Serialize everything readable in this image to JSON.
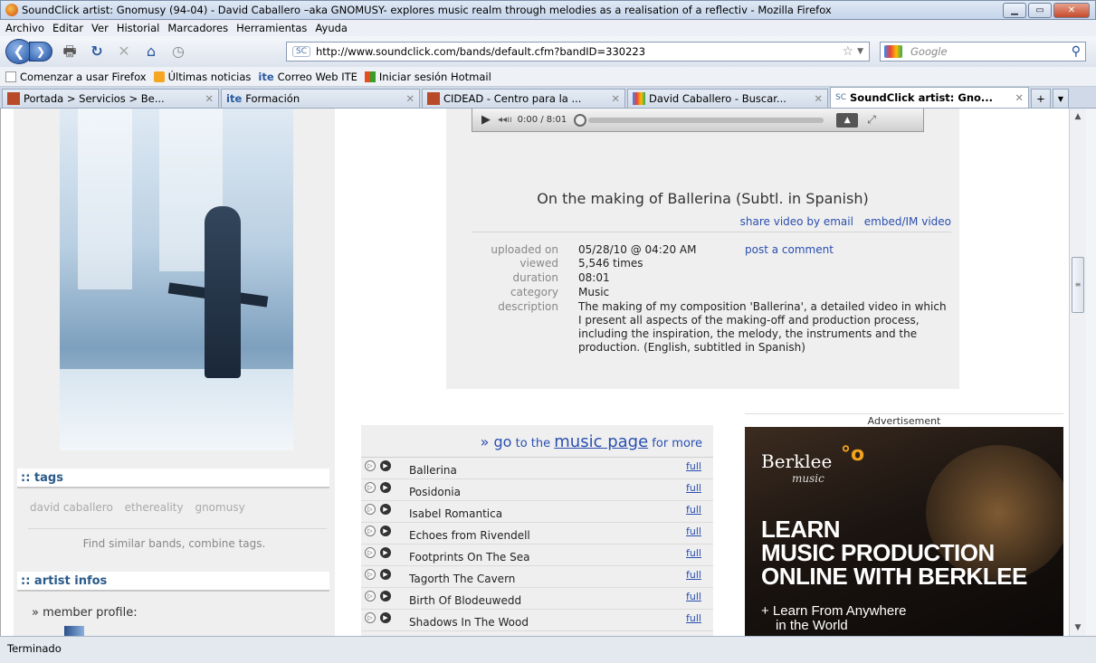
{
  "window": {
    "title": "SoundClick artist: Gnomusy (94-04) - David Caballero –aka GNOMUSY- explores music realm through melodies as a realisation of a reflectiv - Mozilla Firefox",
    "minimize": "▁",
    "maximize": "▭",
    "close": "✕"
  },
  "menu": [
    "Archivo",
    "Editar",
    "Ver",
    "Historial",
    "Marcadores",
    "Herramientas",
    "Ayuda"
  ],
  "nav": {
    "url": "http://www.soundclick.com/bands/default.cfm?bandID=330223",
    "url_badge": "SC",
    "search_placeholder": "Google"
  },
  "bookmarks": [
    "Comenzar a usar Firefox",
    "Últimas noticias",
    "Correo Web ITE",
    "Iniciar sesión Hotmail"
  ],
  "bookmark_prefix_ite": "ite",
  "tabs": [
    {
      "label": "Portada > Servicios > Be...",
      "active": false
    },
    {
      "label": "Formación",
      "prefix": "ite",
      "active": false
    },
    {
      "label": "CIDEAD - Centro para la ...",
      "active": false
    },
    {
      "label": "David Caballero - Buscar...",
      "active": false
    },
    {
      "label": "SoundClick artist: Gno...",
      "prefix": "SC",
      "active": true
    }
  ],
  "player": {
    "time": "0:00 / 8:01",
    "progress": 0
  },
  "video": {
    "title": "On the making of Ballerina (Subtl. in Spanish)",
    "share_link": "share video by email",
    "embed_link": "embed/IM video",
    "uploaded_label": "uploaded on",
    "uploaded": "05/28/10 @ 04:20 AM",
    "post_comment": "post a comment",
    "viewed_label": "viewed",
    "viewed": "5,546 times",
    "duration_label": "duration",
    "duration": "08:01",
    "category_label": "category",
    "category": "Music",
    "description_label": "description",
    "description": "The making of my composition 'Ballerina', a detailed video in which I present all aspects of the making-off and production process, including the inspiration, the melody, the instruments and the production. (English, subtitled in Spanish)"
  },
  "music": {
    "prefix": "» go",
    "mid": " to the ",
    "link": "music page",
    "suffix": " for more",
    "full_label": "full",
    "tracks": [
      "Ballerina",
      "Posidonia",
      "Isabel Romantica",
      "Echoes from Rivendell",
      "Footprints On The Sea",
      "Tagorth The Cavern",
      "Birth Of Blodeuwedd",
      "Shadows In The Wood"
    ]
  },
  "sidebar": {
    "tags_heading": ":: tags",
    "tags": [
      "david caballero",
      "ethereality",
      "gnomusy"
    ],
    "similar": "Find similar bands, combine tags.",
    "artist_heading": ":: artist infos",
    "member_profile": "» member profile:"
  },
  "ad": {
    "label": "Advertisement",
    "brand": "Berklee",
    "brand_sub": "music",
    "line1": "LEARN",
    "line2": "MUSIC PRODUCTION",
    "line3": "ONLINE WITH BERKLEE",
    "sub1": "+ Learn From Anywhere",
    "sub2": "in the World"
  },
  "status": "Terminado",
  "colors": {
    "link": "#2a4fb0",
    "heading": "#2a5a8a",
    "ad_accent": "#f2a21c"
  }
}
